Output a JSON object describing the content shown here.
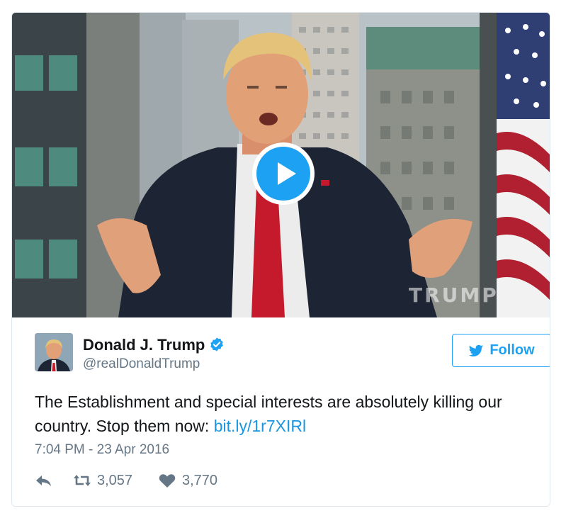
{
  "media": {
    "watermark": "TRUMP"
  },
  "author": {
    "display_name": "Donald J. Trump",
    "handle": "@realDonaldTrump",
    "verified": true,
    "avatar_icon": "profile-photo"
  },
  "follow_button": {
    "label": "Follow",
    "icon": "twitter-bird-icon"
  },
  "tweet": {
    "text": "The Establishment and special interests are absolutely killing our country. Stop them now: ",
    "link_text": "bit.ly/1r7XIRl",
    "timestamp": "7:04 PM - 23 Apr 2016"
  },
  "actions": {
    "reply_icon": "reply-icon",
    "retweet_count": "3,057",
    "like_count": "3,770"
  },
  "colors": {
    "accent": "#1da1f2",
    "link": "#1b95e0",
    "secondary_text": "#657786",
    "border": "#e1e8ed"
  }
}
